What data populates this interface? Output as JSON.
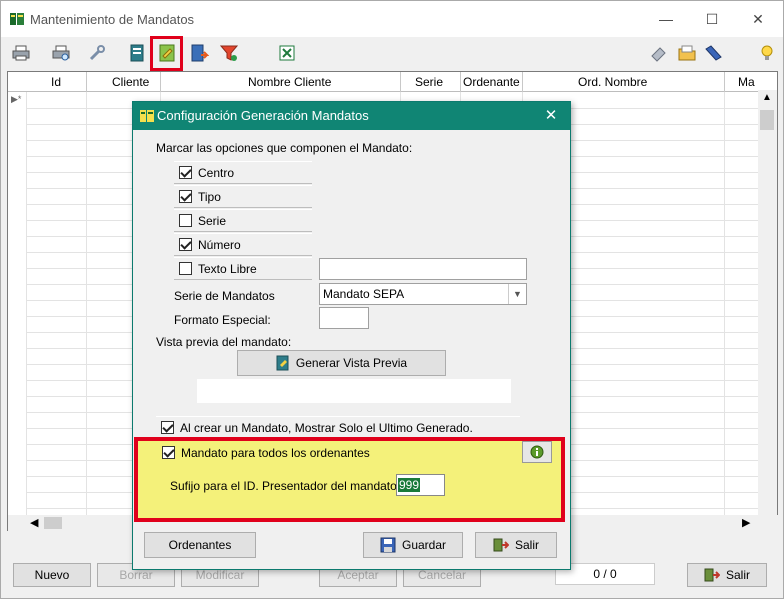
{
  "window": {
    "title": "Mantenimiento de Mandatos",
    "minimize": "—",
    "maximize": "☐",
    "close": "✕"
  },
  "toolbar": {
    "icons": [
      "printer-icon",
      "print-preview-icon",
      "wrench-icon",
      "document-icon",
      "mandate-config-icon",
      "export-document-icon",
      "filter-icon",
      "excel-icon",
      "eraser-icon",
      "open-folder-icon",
      "ruler-icon",
      "lightbulb-icon"
    ]
  },
  "grid": {
    "columns": [
      "Id",
      "Cliente",
      "Nombre Cliente",
      "Serie",
      "Ordenante",
      "Ord. Nombre",
      "Ma"
    ]
  },
  "bottom": {
    "nuevo": "Nuevo",
    "borrar": "Borrar",
    "modificar": "Modificar",
    "aceptar": "Aceptar",
    "cancelar": "Cancelar",
    "counter": "0 / 0",
    "salir": "Salir"
  },
  "dialog": {
    "title": "Configuración Generación Mandatos",
    "close": "✕",
    "options_label": "Marcar las opciones que componen el Mandato:",
    "options": [
      {
        "label": "Centro",
        "checked": true
      },
      {
        "label": "Tipo",
        "checked": true
      },
      {
        "label": "Serie",
        "checked": false
      },
      {
        "label": "Número",
        "checked": true
      },
      {
        "label": "Texto Libre",
        "checked": false
      }
    ],
    "texto_libre_value": "",
    "serie_label": "Serie de Mandatos",
    "serie_value": "Mandato SEPA",
    "formato_label": "Formato Especial:",
    "formato_value": "",
    "preview_label": "Vista previa del mandato:",
    "preview_button": "Generar Vista Previa",
    "preview_value": "",
    "last_generated_label": "Al crear un Mandato, Mostrar Solo el Ultimo Generado.",
    "last_generated_checked": true,
    "all_ordenantes_label": "Mandato para todos los ordenantes",
    "all_ordenantes_checked": true,
    "suffix_label": "Sufijo para el ID. Presentador del mandato",
    "suffix_value": "999",
    "ordenantes_button": "Ordenantes",
    "guardar_button": "Guardar",
    "salir_button": "Salir"
  },
  "colors": {
    "dialog_title_bg": "#108574",
    "highlight_red": "#e0001b",
    "highlight_yellow": "#f4f17a"
  }
}
